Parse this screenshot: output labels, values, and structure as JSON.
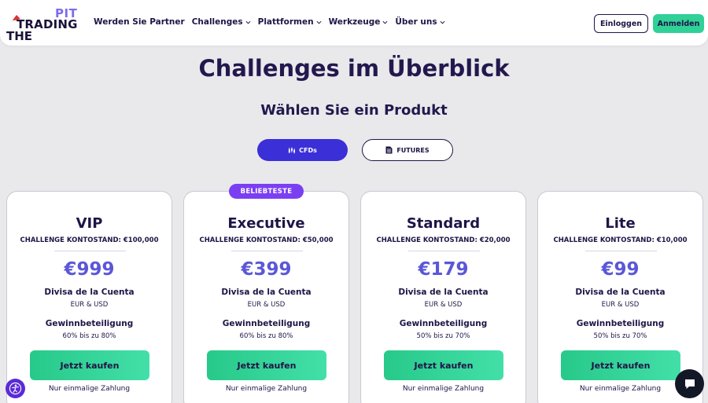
{
  "brand": {
    "logo_top": "PIT",
    "logo_mid": "TRADING",
    "logo_bottom": "THE"
  },
  "nav": {
    "items": [
      {
        "label": "Werden Sie Partner",
        "has_dropdown": false
      },
      {
        "label": "Challenges",
        "has_dropdown": true
      },
      {
        "label": "Plattformen",
        "has_dropdown": true
      },
      {
        "label": "Werkzeuge",
        "has_dropdown": true
      },
      {
        "label": "Über uns",
        "has_dropdown": true
      }
    ],
    "login_label": "Einloggen",
    "signup_label": "Anmelden"
  },
  "page": {
    "title": "Challenges im Überblick",
    "subtitle": "Wählen Sie ein Produkt"
  },
  "product_toggle": {
    "cfds_label": "CFDs",
    "futures_label": "FUTURES",
    "selected": "CFDs"
  },
  "badge": {
    "label": "BELIEBTESTE"
  },
  "cards": [
    {
      "name": "VIP",
      "balance": "CHALLENGE KONTOSTAND: €100,000",
      "price": "€999",
      "currency_label": "Divisa de la Cuenta",
      "currency_value": "EUR & USD",
      "profit_label": "Gewinnbeteiligung",
      "profit_value": "60% bis zu 80%",
      "buy_label": "Jetzt kaufen",
      "payment_note": "Nur einmalige Zahlung"
    },
    {
      "name": "Executive",
      "balance": "CHALLENGE KONTOSTAND: €50,000",
      "price": "€399",
      "currency_label": "Divisa de la Cuenta",
      "currency_value": "EUR & USD",
      "profit_label": "Gewinnbeteiligung",
      "profit_value": "60% bis zu 80%",
      "buy_label": "Jetzt kaufen",
      "payment_note": "Nur einmalige Zahlung"
    },
    {
      "name": "Standard",
      "balance": "CHALLENGE KONTOSTAND: €20,000",
      "price": "€179",
      "currency_label": "Divisa de la Cuenta",
      "currency_value": "EUR & USD",
      "profit_label": "Gewinnbeteiligung",
      "profit_value": "50% bis zu 70%",
      "buy_label": "Jetzt kaufen",
      "payment_note": "Nur einmalige Zahlung"
    },
    {
      "name": "Lite",
      "balance": "CHALLENGE KONTOSTAND: €10,000",
      "price": "€99",
      "currency_label": "Divisa de la Cuenta",
      "currency_value": "EUR & USD",
      "profit_label": "Gewinnbeteiligung",
      "profit_value": "50% bis zu 70%",
      "buy_label": "Jetzt kaufen",
      "payment_note": "Nur einmalige Zahlung"
    }
  ],
  "icons": {
    "accessibility": "accessibility-icon",
    "chat": "chat-icon",
    "candlestick": "candlestick-icon",
    "document": "document-icon"
  },
  "colors": {
    "accent_green": "#2fd197",
    "primary_blue": "#3b2fd8",
    "price_purple": "#5b57d8",
    "badge_purple": "#7b3ff2",
    "text_dark": "#1f1446"
  }
}
